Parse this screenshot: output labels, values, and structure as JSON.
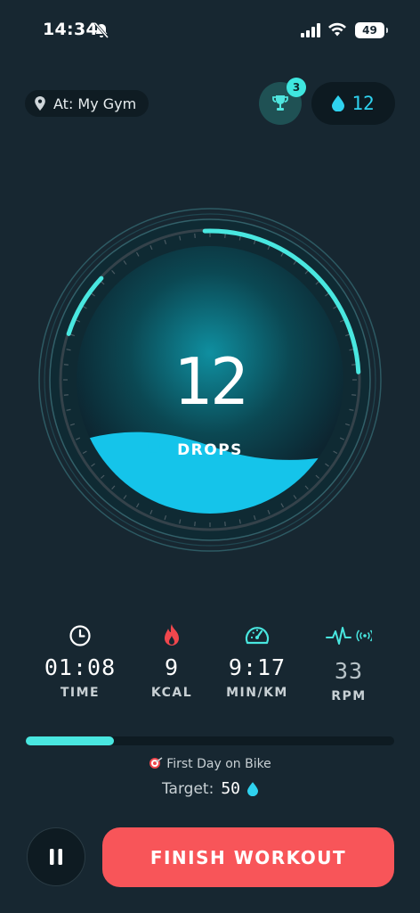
{
  "status_bar": {
    "time": "14:34",
    "battery": "49"
  },
  "header": {
    "location": "At: My Gym",
    "trophy_count": "3",
    "drops_count": "12"
  },
  "gauge": {
    "value": "12",
    "label": "DROPS",
    "fill_fraction": 0.24
  },
  "metrics": [
    {
      "value": "01:08",
      "label": "TIME",
      "icon": "clock-icon"
    },
    {
      "value": "9",
      "label": "KCAL",
      "icon": "flame-icon"
    },
    {
      "value": "9:17",
      "label": "MIN/KM",
      "icon": "speedometer-icon"
    },
    {
      "value": "33",
      "label": "RPM",
      "icon": "heart-rate-icon"
    }
  ],
  "progress": {
    "fraction": 0.24,
    "achievement": "First Day on Bike",
    "target_label": "Target:",
    "target_value": "50"
  },
  "actions": {
    "finish_label": "FINISH WORKOUT"
  },
  "colors": {
    "accent": "#49e7e0",
    "water": "#15c4ea",
    "finish": "#f85559",
    "background": "#172731",
    "flame": "#f0474d"
  }
}
